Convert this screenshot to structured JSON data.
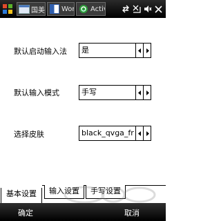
{
  "statusbar": {
    "tasks": [
      {
        "label": "国美",
        "icon": "folder-icon"
      },
      {
        "label": "Wor",
        "icon": "word-icon"
      },
      {
        "label": "Activ",
        "icon": "activesync-icon"
      }
    ],
    "icons": [
      "connectivity-icon",
      "signal-off-icon",
      "volume-icon",
      "close-icon"
    ]
  },
  "settings": [
    {
      "label": "默认启动输入法",
      "value": "是"
    },
    {
      "label": "默认输入模式",
      "value": "手写"
    },
    {
      "label": "选择皮肤",
      "value": "black_qvga_fr"
    }
  ],
  "tabs": [
    "基本设置",
    "输入设置",
    "手写设置"
  ],
  "active_tab": 0,
  "menubar": {
    "left": "确定",
    "right": "取消"
  },
  "colors": {
    "bar_dark": "#000000",
    "bar_light": "#2f2f2f",
    "text_light": "#ffffff"
  }
}
